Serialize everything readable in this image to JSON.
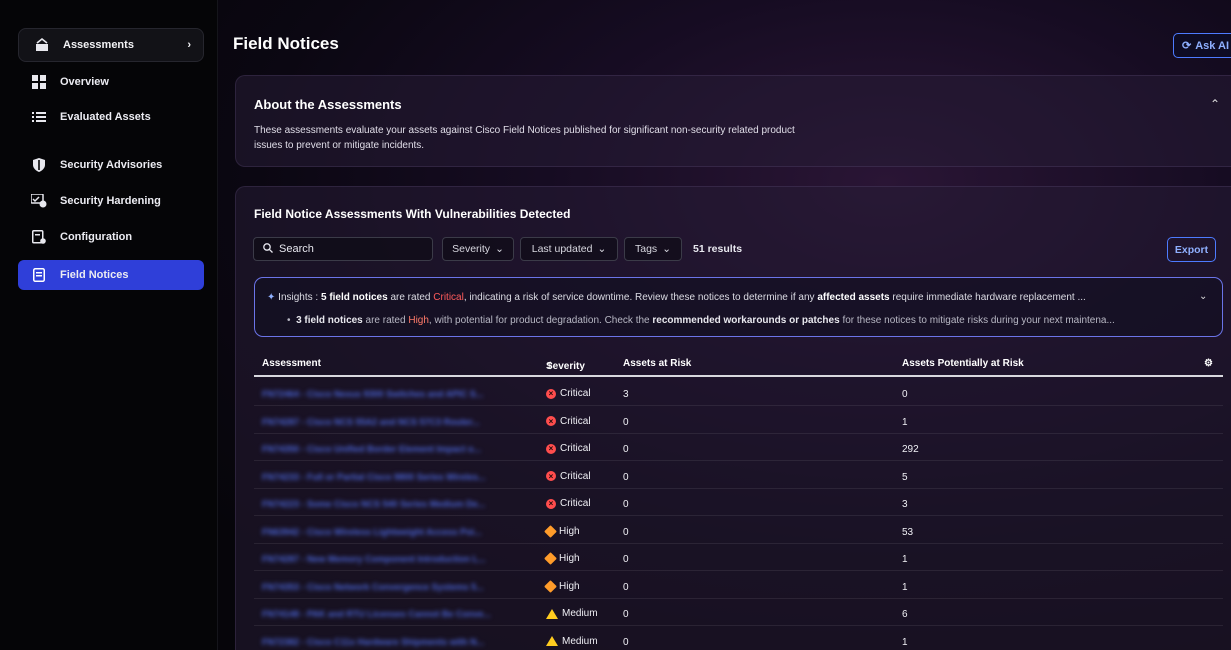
{
  "sidebar": {
    "top": {
      "label": "Assessments",
      "chevron": "›"
    },
    "items": [
      {
        "label": "Overview",
        "icon": "grid-icon"
      },
      {
        "label": "Evaluated Assets",
        "icon": "list-icon"
      },
      {
        "label": "Security Advisories",
        "icon": "shield-icon"
      },
      {
        "label": "Security Hardening",
        "icon": "hardening-icon"
      },
      {
        "label": "Configuration",
        "icon": "config-icon"
      },
      {
        "label": "Field Notices",
        "icon": "document-icon",
        "active": true
      }
    ]
  },
  "header": {
    "title": "Field Notices",
    "ask_ai": "Ask AI"
  },
  "about": {
    "title": "About the Assessments",
    "body": "These assessments evaluate your assets against Cisco Field Notices published for significant non-security related product issues to prevent or mitigate incidents."
  },
  "findings": {
    "title": "Field Notice Assessments With Vulnerabilities Detected",
    "search_placeholder": "Search",
    "filters": [
      "Severity",
      "Last updated",
      "Tags"
    ],
    "results": "51 results",
    "export": "Export",
    "insights": {
      "label": "Insights :",
      "l1_a": "5 field notices",
      "l1_b": " are rated ",
      "l1_c": "Critical",
      "l1_d": ", indicating a risk of service downtime. Review these notices to determine if any ",
      "l1_e": "affected assets",
      "l1_f": " require immediate hardware replacement ...",
      "l2_a": "3 field notices",
      "l2_b": " are rated ",
      "l2_c": "High",
      "l2_d": ", with potential for product degradation. Check the ",
      "l2_e": "recommended workarounds or patches",
      "l2_f": " for these notices to mitigate risks during your next maintena..."
    },
    "columns": [
      "Assessment",
      "Severity",
      "Assets at Risk",
      "Assets Potentially at Risk"
    ],
    "rows": [
      {
        "assessment": "FN72464 - Cisco Nexus 9300 Switches and APIC S...",
        "severity": "Critical",
        "level": "critical",
        "at_risk": "3",
        "potential": "0"
      },
      {
        "assessment": "FN74287 - Cisco NCS 55A2 and NCS 57C3 Router...",
        "severity": "Critical",
        "level": "critical",
        "at_risk": "0",
        "potential": "1"
      },
      {
        "assessment": "FN74350 - Cisco Unified Border Element Impact o...",
        "severity": "Critical",
        "level": "critical",
        "at_risk": "0",
        "potential": "292"
      },
      {
        "assessment": "FN74233 - Full or Partial Cisco 9800 Series Wireles...",
        "severity": "Critical",
        "level": "critical",
        "at_risk": "0",
        "potential": "5"
      },
      {
        "assessment": "FN74223 - Some Cisco NCS 540 Series Medium De...",
        "severity": "Critical",
        "level": "critical",
        "at_risk": "0",
        "potential": "3"
      },
      {
        "assessment": "FN63942 - Cisco Wireless Lightweight Access Poi...",
        "severity": "High",
        "level": "high",
        "at_risk": "0",
        "potential": "53"
      },
      {
        "assessment": "FN74287 - New Memory Component Introduction L...",
        "severity": "High",
        "level": "high",
        "at_risk": "0",
        "potential": "1"
      },
      {
        "assessment": "FN74353 - Cisco Network Convergence Systems 5...",
        "severity": "High",
        "level": "high",
        "at_risk": "0",
        "potential": "1"
      },
      {
        "assessment": "FN74148 - PAK and RTU Licenses Cannot Be Conve...",
        "severity": "Medium",
        "level": "medium",
        "at_risk": "0",
        "potential": "6"
      },
      {
        "assessment": "FN72382 - Cisco C11x Hardware Shipments with N...",
        "severity": "Medium",
        "level": "medium",
        "at_risk": "0",
        "potential": "1"
      }
    ]
  },
  "colors": {
    "accent": "#2f3fd9",
    "link": "#4d7bff",
    "critical": "#ff4d4d",
    "high": "#ff9c2a",
    "medium": "#ffcc1f"
  }
}
